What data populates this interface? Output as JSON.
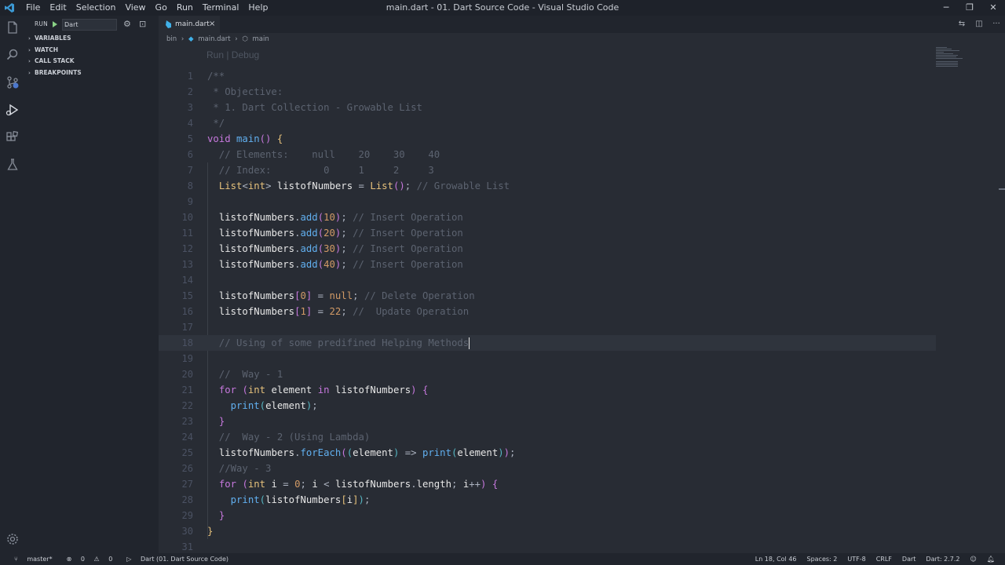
{
  "titlebar": {
    "menu": [
      "File",
      "Edit",
      "Selection",
      "View",
      "Go",
      "Run",
      "Terminal",
      "Help"
    ],
    "title": "main.dart - 01. Dart Source Code - Visual Studio Code"
  },
  "run_panel": {
    "run_label": "RUN",
    "config": "Dart",
    "sections": [
      "VARIABLES",
      "WATCH",
      "CALL STACK",
      "BREAKPOINTS"
    ]
  },
  "tab": {
    "label": "main.dart",
    "close": "×"
  },
  "breadcrumb": [
    "bin",
    "main.dart",
    "main"
  ],
  "codelens": "Run | Debug",
  "code_lines": [
    {
      "n": "1",
      "tokens": [
        {
          "c": "c-com",
          "t": "/**"
        }
      ]
    },
    {
      "n": "2",
      "tokens": [
        {
          "c": "c-com",
          "t": " * Objective:"
        }
      ]
    },
    {
      "n": "3",
      "tokens": [
        {
          "c": "c-com",
          "t": " * 1. Dart Collection - Growable List"
        }
      ]
    },
    {
      "n": "4",
      "tokens": [
        {
          "c": "c-com",
          "t": " */"
        }
      ]
    },
    {
      "n": "5",
      "tokens": [
        {
          "c": "c-kw",
          "t": "void "
        },
        {
          "c": "c-fn",
          "t": "main"
        },
        {
          "c": "c-br2",
          "t": "() "
        },
        {
          "c": "c-br1",
          "t": "{"
        }
      ]
    },
    {
      "n": "6",
      "tokens": [
        {
          "c": "c-com",
          "t": "  // Elements:    null    20    30    40"
        }
      ]
    },
    {
      "n": "7",
      "tokens": [
        {
          "c": "c-com",
          "t": "  // Index:         0     1     2     3"
        }
      ]
    },
    {
      "n": "8",
      "tokens": [
        {
          "c": "c-pl",
          "t": "  "
        },
        {
          "c": "c-type",
          "t": "List"
        },
        {
          "c": "c-pl",
          "t": "<"
        },
        {
          "c": "c-type",
          "t": "int"
        },
        {
          "c": "c-pl",
          "t": "> "
        },
        {
          "c": "c-txt",
          "t": "listofNumbers"
        },
        {
          "c": "c-pl",
          "t": " = "
        },
        {
          "c": "c-type",
          "t": "List"
        },
        {
          "c": "c-br2",
          "t": "()"
        },
        {
          "c": "c-pl",
          "t": "; "
        },
        {
          "c": "c-com",
          "t": "// Growable List"
        }
      ]
    },
    {
      "n": "9",
      "tokens": []
    },
    {
      "n": "10",
      "tokens": [
        {
          "c": "c-pl",
          "t": "  "
        },
        {
          "c": "c-txt",
          "t": "listofNumbers"
        },
        {
          "c": "c-pl",
          "t": "."
        },
        {
          "c": "c-fn",
          "t": "add"
        },
        {
          "c": "c-br2",
          "t": "("
        },
        {
          "c": "c-num",
          "t": "10"
        },
        {
          "c": "c-br2",
          "t": ")"
        },
        {
          "c": "c-pl",
          "t": "; "
        },
        {
          "c": "c-com",
          "t": "// Insert Operation"
        }
      ]
    },
    {
      "n": "11",
      "tokens": [
        {
          "c": "c-pl",
          "t": "  "
        },
        {
          "c": "c-txt",
          "t": "listofNumbers"
        },
        {
          "c": "c-pl",
          "t": "."
        },
        {
          "c": "c-fn",
          "t": "add"
        },
        {
          "c": "c-br2",
          "t": "("
        },
        {
          "c": "c-num",
          "t": "20"
        },
        {
          "c": "c-br2",
          "t": ")"
        },
        {
          "c": "c-pl",
          "t": "; "
        },
        {
          "c": "c-com",
          "t": "// Insert Operation"
        }
      ]
    },
    {
      "n": "12",
      "tokens": [
        {
          "c": "c-pl",
          "t": "  "
        },
        {
          "c": "c-txt",
          "t": "listofNumbers"
        },
        {
          "c": "c-pl",
          "t": "."
        },
        {
          "c": "c-fn",
          "t": "add"
        },
        {
          "c": "c-br2",
          "t": "("
        },
        {
          "c": "c-num",
          "t": "30"
        },
        {
          "c": "c-br2",
          "t": ")"
        },
        {
          "c": "c-pl",
          "t": "; "
        },
        {
          "c": "c-com",
          "t": "// Insert Operation"
        }
      ]
    },
    {
      "n": "13",
      "tokens": [
        {
          "c": "c-pl",
          "t": "  "
        },
        {
          "c": "c-txt",
          "t": "listofNumbers"
        },
        {
          "c": "c-pl",
          "t": "."
        },
        {
          "c": "c-fn",
          "t": "add"
        },
        {
          "c": "c-br2",
          "t": "("
        },
        {
          "c": "c-num",
          "t": "40"
        },
        {
          "c": "c-br2",
          "t": ")"
        },
        {
          "c": "c-pl",
          "t": "; "
        },
        {
          "c": "c-com",
          "t": "// Insert Operation"
        }
      ]
    },
    {
      "n": "14",
      "tokens": []
    },
    {
      "n": "15",
      "tokens": [
        {
          "c": "c-pl",
          "t": "  "
        },
        {
          "c": "c-txt",
          "t": "listofNumbers"
        },
        {
          "c": "c-br2",
          "t": "["
        },
        {
          "c": "c-num",
          "t": "0"
        },
        {
          "c": "c-br2",
          "t": "]"
        },
        {
          "c": "c-pl",
          "t": " = "
        },
        {
          "c": "c-num",
          "t": "null"
        },
        {
          "c": "c-pl",
          "t": "; "
        },
        {
          "c": "c-com",
          "t": "// Delete Operation"
        }
      ]
    },
    {
      "n": "16",
      "tokens": [
        {
          "c": "c-pl",
          "t": "  "
        },
        {
          "c": "c-txt",
          "t": "listofNumbers"
        },
        {
          "c": "c-br2",
          "t": "["
        },
        {
          "c": "c-num",
          "t": "1"
        },
        {
          "c": "c-br2",
          "t": "]"
        },
        {
          "c": "c-pl",
          "t": " = "
        },
        {
          "c": "c-num",
          "t": "22"
        },
        {
          "c": "c-pl",
          "t": "; "
        },
        {
          "c": "c-com",
          "t": "//  Update Operation"
        }
      ]
    },
    {
      "n": "17",
      "tokens": []
    },
    {
      "n": "18",
      "tokens": [
        {
          "c": "c-com",
          "t": "  // Using of some predifined Helping Methods"
        }
      ],
      "cursor": true,
      "hl": true
    },
    {
      "n": "19",
      "tokens": []
    },
    {
      "n": "20",
      "tokens": [
        {
          "c": "c-com",
          "t": "  //  Way - 1"
        }
      ]
    },
    {
      "n": "21",
      "tokens": [
        {
          "c": "c-pl",
          "t": "  "
        },
        {
          "c": "c-kw",
          "t": "for"
        },
        {
          "c": "c-pl",
          "t": " "
        },
        {
          "c": "c-br2",
          "t": "("
        },
        {
          "c": "c-type",
          "t": "int"
        },
        {
          "c": "c-pl",
          "t": " "
        },
        {
          "c": "c-txt",
          "t": "element"
        },
        {
          "c": "c-pl",
          "t": " "
        },
        {
          "c": "c-kw",
          "t": "in"
        },
        {
          "c": "c-pl",
          "t": " "
        },
        {
          "c": "c-txt",
          "t": "listofNumbers"
        },
        {
          "c": "c-br2",
          "t": ")"
        },
        {
          "c": "c-pl",
          "t": " "
        },
        {
          "c": "c-br2",
          "t": "{"
        }
      ]
    },
    {
      "n": "22",
      "tokens": [
        {
          "c": "c-pl",
          "t": "    "
        },
        {
          "c": "c-fn",
          "t": "print"
        },
        {
          "c": "c-br3",
          "t": "("
        },
        {
          "c": "c-txt",
          "t": "element"
        },
        {
          "c": "c-br3",
          "t": ")"
        },
        {
          "c": "c-pl",
          "t": ";"
        }
      ]
    },
    {
      "n": "23",
      "tokens": [
        {
          "c": "c-pl",
          "t": "  "
        },
        {
          "c": "c-br2",
          "t": "}"
        }
      ]
    },
    {
      "n": "24",
      "tokens": [
        {
          "c": "c-com",
          "t": "  //  Way - 2 (Using Lambda)"
        }
      ]
    },
    {
      "n": "25",
      "tokens": [
        {
          "c": "c-pl",
          "t": "  "
        },
        {
          "c": "c-txt",
          "t": "listofNumbers"
        },
        {
          "c": "c-pl",
          "t": "."
        },
        {
          "c": "c-fn",
          "t": "forEach"
        },
        {
          "c": "c-br2",
          "t": "("
        },
        {
          "c": "c-br3",
          "t": "("
        },
        {
          "c": "c-txt",
          "t": "element"
        },
        {
          "c": "c-br3",
          "t": ")"
        },
        {
          "c": "c-pl",
          "t": " => "
        },
        {
          "c": "c-fn",
          "t": "print"
        },
        {
          "c": "c-br3",
          "t": "("
        },
        {
          "c": "c-txt",
          "t": "element"
        },
        {
          "c": "c-br3",
          "t": ")"
        },
        {
          "c": "c-br2",
          "t": ")"
        },
        {
          "c": "c-pl",
          "t": ";"
        }
      ]
    },
    {
      "n": "26",
      "tokens": [
        {
          "c": "c-com",
          "t": "  //Way - 3"
        }
      ]
    },
    {
      "n": "27",
      "tokens": [
        {
          "c": "c-pl",
          "t": "  "
        },
        {
          "c": "c-kw",
          "t": "for"
        },
        {
          "c": "c-pl",
          "t": " "
        },
        {
          "c": "c-br2",
          "t": "("
        },
        {
          "c": "c-type",
          "t": "int"
        },
        {
          "c": "c-pl",
          "t": " "
        },
        {
          "c": "c-txt",
          "t": "i"
        },
        {
          "c": "c-pl",
          "t": " = "
        },
        {
          "c": "c-num",
          "t": "0"
        },
        {
          "c": "c-pl",
          "t": "; "
        },
        {
          "c": "c-txt",
          "t": "i"
        },
        {
          "c": "c-pl",
          "t": " < "
        },
        {
          "c": "c-txt",
          "t": "listofNumbers"
        },
        {
          "c": "c-pl",
          "t": "."
        },
        {
          "c": "c-txt",
          "t": "length"
        },
        {
          "c": "c-pl",
          "t": "; "
        },
        {
          "c": "c-txt",
          "t": "i"
        },
        {
          "c": "c-pl",
          "t": "++"
        },
        {
          "c": "c-br2",
          "t": ")"
        },
        {
          "c": "c-pl",
          "t": " "
        },
        {
          "c": "c-br2",
          "t": "{"
        }
      ]
    },
    {
      "n": "28",
      "tokens": [
        {
          "c": "c-pl",
          "t": "    "
        },
        {
          "c": "c-fn",
          "t": "print"
        },
        {
          "c": "c-br3",
          "t": "("
        },
        {
          "c": "c-txt",
          "t": "listofNumbers"
        },
        {
          "c": "c-br1",
          "t": "["
        },
        {
          "c": "c-txt",
          "t": "i"
        },
        {
          "c": "c-br1",
          "t": "]"
        },
        {
          "c": "c-br3",
          "t": ")"
        },
        {
          "c": "c-pl",
          "t": ";"
        }
      ]
    },
    {
      "n": "29",
      "tokens": [
        {
          "c": "c-pl",
          "t": "  "
        },
        {
          "c": "c-br2",
          "t": "}"
        }
      ]
    },
    {
      "n": "30",
      "tokens": [
        {
          "c": "c-br1",
          "t": "}"
        }
      ]
    },
    {
      "n": "31",
      "tokens": []
    }
  ],
  "status": {
    "branch": "master*",
    "errors": "0",
    "warnings": "0",
    "debug": "Dart (01. Dart Source Code)",
    "position": "Ln 18, Col 46",
    "spaces": "Spaces: 2",
    "encoding": "UTF-8",
    "eol": "CRLF",
    "language": "Dart",
    "sdk": "Dart: 2.7.2"
  },
  "colors": {
    "accent": "#61afef",
    "comment": "#5c6370",
    "keyword": "#c678dd",
    "number": "#d19a66"
  }
}
